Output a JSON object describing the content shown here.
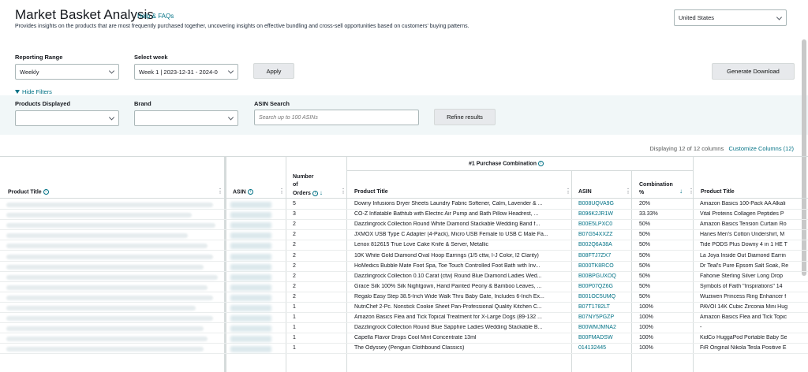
{
  "header": {
    "title": "Market Basket Analysis",
    "help_link": "Help & FAQs",
    "description": "Provides insights on the products that are most frequently purchased together, uncovering insights on effective bundling and cross-sell opportunities based on customers' buying patterns.",
    "country": "United States"
  },
  "filters": {
    "reporting_range_label": "Reporting Range",
    "reporting_range_value": "Weekly",
    "select_week_label": "Select week",
    "select_week_value": "Week 1 | 2023-12-31 - 2024-0",
    "apply_label": "Apply",
    "generate_label": "Generate Download",
    "hide_filters_label": "Hide Filters",
    "products_displayed_label": "Products Displayed",
    "brand_label": "Brand",
    "asin_search_label": "ASIN Search",
    "asin_search_placeholder": "Search up to 100 ASINs",
    "refine_label": "Refine results"
  },
  "table_info": {
    "displaying": "Displaying 12 of 12 columns",
    "customize": "Customize Columns (12)"
  },
  "table": {
    "group_header": "#1 Purchase Combination",
    "col_product_title": "Product Title",
    "col_asin": "ASIN",
    "col_orders_1": "Number",
    "col_orders_2": "of",
    "col_orders_3": "Orders",
    "col_p1_title": "Product Title",
    "col_p1_asin": "ASIN",
    "col_combo_1": "Combination",
    "col_combo_2": "%",
    "col_p2_title": "Product Title",
    "rows": [
      {
        "orders": "5",
        "title": "Downy Infusions Dryer Sheets Laundry Fabric Softener, Calm, Lavender & ...",
        "asin": "B008UQVA9G",
        "combo": "20%",
        "title2": "Amazon Basics 100-Pack AA Alkali"
      },
      {
        "orders": "3",
        "title": "CO-Z Inflatable Bathtub with Electric Air Pump and Bath Pillow Headrest, ...",
        "asin": "B096K2JR1W",
        "combo": "33.33%",
        "title2": "Vital Proteins Collagen Peptides P"
      },
      {
        "orders": "2",
        "title": "Dazzlingrock Collection Round White Diamond Stackable Wedding Band f...",
        "asin": "B00E5LPXC0",
        "combo": "50%",
        "title2": "Amazon Basics Tension Curtain Ro"
      },
      {
        "orders": "2",
        "title": "JXMOX USB Type C Adapter (4-Pack), Micro USB Female to USB C Male Fa...",
        "asin": "B07G54XXZZ",
        "combo": "50%",
        "title2": "Hanes Men's Cotton Undershirt, M"
      },
      {
        "orders": "2",
        "title": "Lenox 812615 True Love Cake Knife & Server, Metallic",
        "asin": "B002Q6A38A",
        "combo": "50%",
        "title2": "Tide PODS Plus Downy 4 in 1 HE T"
      },
      {
        "orders": "2",
        "title": "10K White Gold Diamond Oval Hoop Earrings (1/5 cttw, I-J Color, I2 Clarity)",
        "asin": "B08FTJ7ZX7",
        "combo": "50%",
        "title2": "La Joya Inside Out Diamond Earrin"
      },
      {
        "orders": "2",
        "title": "HoMedics Bubble Mate Foot Spa, Toe Touch Controlled Foot Bath with Inv...",
        "asin": "B000TK8RCO",
        "combo": "50%",
        "title2": "Dr Teal's Pure Epsom Salt Soak, Re"
      },
      {
        "orders": "2",
        "title": "Dazzlingrock Collection 0.10 Carat (ctw) Round Blue Diamond Ladies Wed...",
        "asin": "B00BPGUXOQ",
        "combo": "50%",
        "title2": "Fahonie Sterling Silver Long Drop"
      },
      {
        "orders": "2",
        "title": "Grace Silk 100% Silk Nightgown, Hand Painted Peony & Bamboo Leaves, ...",
        "asin": "B00P07QZ6G",
        "combo": "50%",
        "title2": "Symbols of Faith \"Inspirations\" 14"
      },
      {
        "orders": "2",
        "title": "Regalo Easy Step 38.5-Inch Wide Walk Thru Baby Gate, Includes 6-Inch Ex...",
        "asin": "B001OC5UMQ",
        "combo": "50%",
        "title2": "Wuziwen Princess Ring Enhancer f"
      },
      {
        "orders": "1",
        "title": "NutriChef 2-Pc. Nonstick Cookie Sheet Pan-Professional Quality Kitchen C...",
        "asin": "B07T1782LT",
        "combo": "100%",
        "title2": "PAVOI 14K Cubic Zirconia Mini Hug"
      },
      {
        "orders": "1",
        "title": "Amazon Basics Flea and Tick Topical Treatment for X-Large Dogs (89-132 ...",
        "asin": "B07NY5PGZP",
        "combo": "100%",
        "title2": "Amazon Basics Flea and Tick Topic"
      },
      {
        "orders": "1",
        "title": "Dazzlingrock Collection Round Blue Sapphire Ladies Wedding Stackable B...",
        "asin": "B00WMJMNA2",
        "combo": "100%",
        "title2": "-"
      },
      {
        "orders": "1",
        "title": "Capella Flavor Drops Cool Mint Concentrate 13ml",
        "asin": "B00FMADSW",
        "combo": "100%",
        "title2": "KidCo HuggaPod Portable Baby Se"
      },
      {
        "orders": "1",
        "title": "The Odyssey (Penguin Clothbound Classics)",
        "asin": "014132445",
        "combo": "100%",
        "title2": "FiR Original Nikola Tesla Positive E"
      }
    ]
  }
}
